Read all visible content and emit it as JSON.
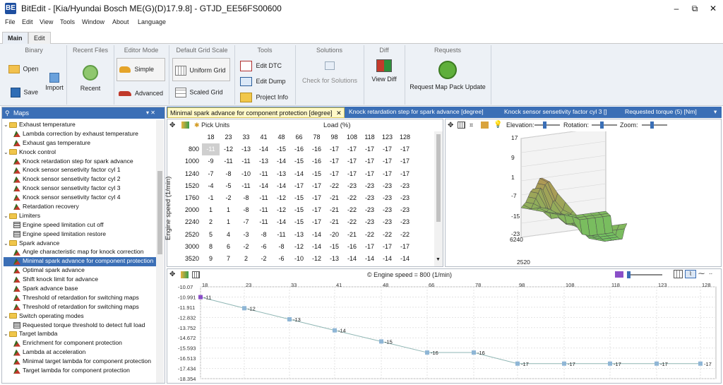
{
  "window": {
    "title": "BitEdit - [Kia/Hyundai Bosch ME(G)(D)17.9.8] - GTJD_EE56FS00600",
    "app_icon": "BE",
    "minimize": "–",
    "restore": "⧉",
    "close": "✕"
  },
  "menu": [
    "File",
    "Edit",
    "View",
    "Tools",
    "Window",
    "About",
    "Language"
  ],
  "ribbon_tabs": [
    "Main",
    "Edit"
  ],
  "ribbon": {
    "binary": {
      "title": "Binary",
      "open": "Open",
      "import": "Import",
      "save": "Save"
    },
    "recent_files": {
      "title": "Recent Files",
      "recent": "Recent"
    },
    "editor_mode": {
      "title": "Editor Mode",
      "simple": "Simple",
      "advanced": "Advanced"
    },
    "grid_scale": {
      "title": "Default Grid Scale",
      "uniform": "Uniform Grid",
      "scaled": "Scaled Grid"
    },
    "tools": {
      "title": "Tools",
      "edit_dtc": "Edit DTC",
      "edit_dump": "Edit Dump",
      "project_info": "Project Info"
    },
    "solutions": {
      "title": "Solutions",
      "check": "Check for Solutions"
    },
    "diff": {
      "title": "Diff",
      "view_diff": "View Diff"
    },
    "requests": {
      "title": "Requests",
      "request_map_pack": "Request Map Pack Update"
    }
  },
  "maps_panel": {
    "title": "Maps",
    "pin": "▾ ✕",
    "tree": [
      {
        "level": 0,
        "type": "folder",
        "label": "Exhaust temperature"
      },
      {
        "level": 1,
        "type": "map",
        "label": "Lambda correction by exhaust temperature"
      },
      {
        "level": 1,
        "type": "map",
        "label": "Exhaust gas temperature"
      },
      {
        "level": 0,
        "type": "folder",
        "label": "Knock control"
      },
      {
        "level": 1,
        "type": "map",
        "label": "Knock retardation step for spark advance"
      },
      {
        "level": 1,
        "type": "map",
        "label": "Knock sensor sensetivity factor cyl 1"
      },
      {
        "level": 1,
        "type": "map",
        "label": "Knock sensor sensetivity factor cyl 2"
      },
      {
        "level": 1,
        "type": "map",
        "label": "Knock sensor sensetivity factor cyl 3"
      },
      {
        "level": 1,
        "type": "map",
        "label": "Knock sensor sensetivity factor cyl 4"
      },
      {
        "level": 1,
        "type": "map",
        "label": "Retardation recovery"
      },
      {
        "level": 0,
        "type": "folder",
        "label": "Limiters"
      },
      {
        "level": 1,
        "type": "table",
        "label": "Engine speed limitation cut off"
      },
      {
        "level": 1,
        "type": "table",
        "label": "Engine speed limitation restore"
      },
      {
        "level": 0,
        "type": "folder",
        "label": "Spark advance"
      },
      {
        "level": 1,
        "type": "map",
        "label": "Angle characteristic map for knock correction"
      },
      {
        "level": 1,
        "type": "map",
        "label": "Minimal spark advance for component protection",
        "selected": true
      },
      {
        "level": 1,
        "type": "map",
        "label": "Optimal spark advance"
      },
      {
        "level": 1,
        "type": "map",
        "label": "Shift knock limit for advance"
      },
      {
        "level": 1,
        "type": "map",
        "label": "Spark advance base"
      },
      {
        "level": 1,
        "type": "map",
        "label": "Threshold of retardation for switching maps"
      },
      {
        "level": 1,
        "type": "map",
        "label": "Threshold of retardation for switching maps"
      },
      {
        "level": 0,
        "type": "folder",
        "label": "Switch operating modes"
      },
      {
        "level": 1,
        "type": "table",
        "label": "Requested torque threshold to detect full load"
      },
      {
        "level": 0,
        "type": "folder",
        "label": "Target lambda"
      },
      {
        "level": 1,
        "type": "map",
        "label": "Enrichment for component protection"
      },
      {
        "level": 1,
        "type": "map",
        "label": "Lambda at acceleration"
      },
      {
        "level": 1,
        "type": "map",
        "label": "Minimal target lambda for component protection"
      },
      {
        "level": 1,
        "type": "map",
        "label": "Target lambda for component protection"
      }
    ]
  },
  "doc_tabs": [
    {
      "label": "Minimal spark advance for component protection [degree]",
      "active": true,
      "close": "✕"
    },
    {
      "label": "Knock retardation step for spark advance [degree]"
    },
    {
      "label": "Knock sensor sensetivity factor cyl 3 []"
    },
    {
      "label": "Requested torque (5) [Nm]"
    }
  ],
  "table_toolbar": {
    "pick_units": "Pick Units",
    "x_axis_title": "Load (%)",
    "y_axis_title": "Engine speed (1/min)"
  },
  "grid": {
    "x_axis": [
      "18",
      "23",
      "33",
      "41",
      "48",
      "66",
      "78",
      "98",
      "108",
      "118",
      "123",
      "128"
    ],
    "y_axis": [
      "800",
      "1000",
      "1240",
      "1520",
      "1760",
      "2000",
      "2240",
      "2520",
      "3000",
      "3520"
    ],
    "cells": [
      [
        "-11",
        "-12",
        "-13",
        "-14",
        "-15",
        "-16",
        "-16",
        "-17",
        "-17",
        "-17",
        "-17",
        "-17"
      ],
      [
        "-9",
        "-11",
        "-11",
        "-13",
        "-14",
        "-15",
        "-16",
        "-17",
        "-17",
        "-17",
        "-17",
        "-17"
      ],
      [
        "-7",
        "-8",
        "-10",
        "-11",
        "-13",
        "-14",
        "-15",
        "-17",
        "-17",
        "-17",
        "-17",
        "-17"
      ],
      [
        "-4",
        "-5",
        "-11",
        "-14",
        "-14",
        "-17",
        "-17",
        "-22",
        "-23",
        "-23",
        "-23",
        "-23"
      ],
      [
        "-1",
        "-2",
        "-8",
        "-11",
        "-12",
        "-15",
        "-17",
        "-21",
        "-22",
        "-23",
        "-23",
        "-23"
      ],
      [
        "1",
        "1",
        "-8",
        "-11",
        "-12",
        "-15",
        "-17",
        "-21",
        "-22",
        "-23",
        "-23",
        "-23"
      ],
      [
        "2",
        "1",
        "-7",
        "-11",
        "-14",
        "-15",
        "-17",
        "-21",
        "-22",
        "-23",
        "-23",
        "-23"
      ],
      [
        "5",
        "4",
        "-3",
        "-8",
        "-11",
        "-13",
        "-14",
        "-20",
        "-21",
        "-22",
        "-22",
        "-22"
      ],
      [
        "8",
        "6",
        "-2",
        "-6",
        "-8",
        "-12",
        "-14",
        "-15",
        "-16",
        "-17",
        "-17",
        "-17"
      ],
      [
        "9",
        "7",
        "2",
        "-2",
        "-6",
        "-10",
        "-12",
        "-13",
        "-14",
        "-14",
        "-14",
        "-14"
      ]
    ],
    "selected_cell": [
      0,
      0
    ]
  },
  "graph3d": {
    "elevation_label": "Elevation:",
    "rotation_label": "Rotation:",
    "zoom_label": "Zoom:",
    "z_ticks": [
      "17",
      "9",
      "1",
      "-7",
      "-15",
      "-23"
    ],
    "y_ticks": [
      "6240",
      "2520"
    ],
    "colors": {
      "high": "#c48a55",
      "mid": "#b7cf79",
      "low": "#73c160"
    }
  },
  "line_view": {
    "caption": "© Engine speed = 800 (1/min)",
    "y_ticks": [
      "-10.07",
      "-10.991",
      "-11.911",
      "-12.832",
      "-13.752",
      "-14.672",
      "-15.593",
      "-16.513",
      "-17.434",
      "-18.354"
    ],
    "x_ticks": [
      "18",
      "23",
      "33",
      "41",
      "48",
      "66",
      "78",
      "98",
      "108",
      "118",
      "123",
      "128"
    ]
  },
  "chart_data": {
    "type": "line",
    "title": "© Engine speed = 800 (1/min)",
    "xlabel": "",
    "ylabel": "",
    "categories": [
      "18",
      "23",
      "33",
      "41",
      "48",
      "66",
      "78",
      "98",
      "108",
      "118",
      "123",
      "128"
    ],
    "series": [
      {
        "values": [
          -11,
          -12,
          -13,
          -14,
          -15,
          -16,
          -16,
          -17,
          -17,
          -17,
          -17,
          -17
        ]
      }
    ],
    "point_labels": [
      "-11",
      "-12",
      "-13",
      "-14",
      "-15",
      "-16",
      "-16",
      "-17",
      "-17",
      "-17",
      "-17",
      "-17"
    ],
    "ylim": [
      -18.354,
      -10.07
    ],
    "grid": true
  }
}
